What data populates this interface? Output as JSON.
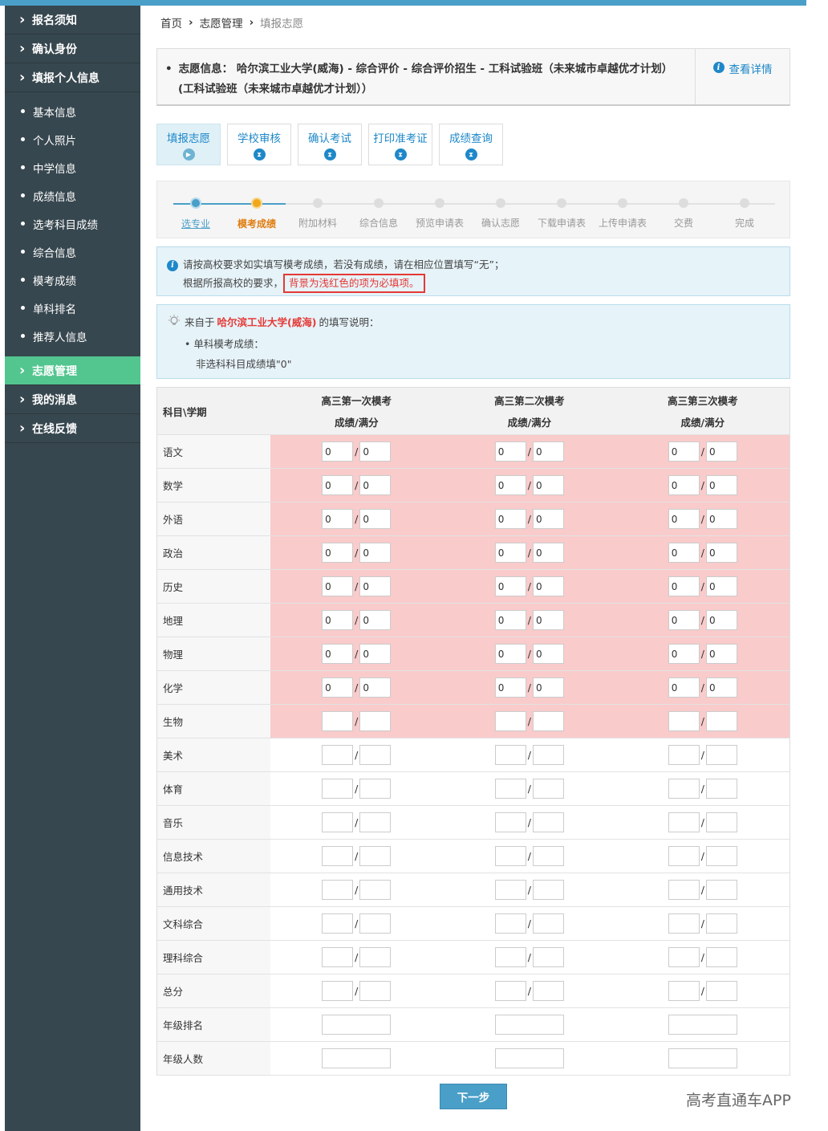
{
  "sidebar": {
    "main_items_top": [
      {
        "label": "报名须知",
        "icon": "chevron-right-icon"
      },
      {
        "label": "确认身份",
        "icon": "chevron-right-icon"
      },
      {
        "label": "填报个人信息",
        "icon": "chevron-right-icon"
      }
    ],
    "sub_items": [
      "基本信息",
      "个人照片",
      "中学信息",
      "成绩信息",
      "选考科目成绩",
      "综合信息",
      "模考成绩",
      "单科排名",
      "推荐人信息"
    ],
    "main_items_bottom": [
      {
        "label": "志愿管理",
        "icon": "chevron-right-icon",
        "active": true
      },
      {
        "label": "我的消息",
        "icon": "chevron-right-icon"
      },
      {
        "label": "在线反馈",
        "icon": "chevron-right-icon"
      }
    ],
    "active_color": "#53c58f"
  },
  "breadcrumb": {
    "items": [
      "首页",
      "志愿管理",
      "填报志愿"
    ],
    "separator": "›"
  },
  "info": {
    "label": "志愿信息：",
    "line1": "哈尔滨工业大学(威海) - 综合评价 - 综合评价招生 - 工科试验班（未来城市卓越优才计划）",
    "line2": "(工科试验班（未来城市卓越优才计划））",
    "detail_link": "查看详情"
  },
  "tabs": [
    {
      "label": "填报志愿",
      "icon": "play-icon",
      "active": true
    },
    {
      "label": "学校审核",
      "icon": "hourglass-icon"
    },
    {
      "label": "确认考试",
      "icon": "hourglass-icon"
    },
    {
      "label": "打印准考证",
      "icon": "hourglass-icon"
    },
    {
      "label": "成绩查询",
      "icon": "hourglass-icon"
    }
  ],
  "steps": [
    "选专业",
    "模考成绩",
    "附加材料",
    "综合信息",
    "预览申请表",
    "确认志愿",
    "下载申请表",
    "上传申请表",
    "交费",
    "完成"
  ],
  "notice": {
    "line1": "请按高校要求如实填写模考成绩，若没有成绩，请在相应位置填写“无”；",
    "line2_prefix": "根据所报高校的要求，",
    "line2_highlight": "背景为浅红色的项为必填项。"
  },
  "description": {
    "prefix": "来自于",
    "school": "哈尔滨工业大学(威海)",
    "suffix": "的填写说明：",
    "item": "单科模考成绩：",
    "note": "非选科科目成绩填\"0\""
  },
  "table": {
    "subject_header": "科目\\学期",
    "columns": [
      {
        "title": "高三第一次模考",
        "subtitle": "成绩/满分"
      },
      {
        "title": "高三第二次模考",
        "subtitle": "成绩/满分"
      },
      {
        "title": "高三第三次模考",
        "subtitle": "成绩/满分"
      }
    ],
    "required_color": "#f9cbcb",
    "rows": [
      {
        "subject": "语文",
        "required": true,
        "score": "0",
        "full": "0"
      },
      {
        "subject": "数学",
        "required": true,
        "score": "0",
        "full": "0"
      },
      {
        "subject": "外语",
        "required": true,
        "score": "0",
        "full": "0"
      },
      {
        "subject": "政治",
        "required": true,
        "score": "0",
        "full": "0"
      },
      {
        "subject": "历史",
        "required": true,
        "score": "0",
        "full": "0"
      },
      {
        "subject": "地理",
        "required": true,
        "score": "0",
        "full": "0"
      },
      {
        "subject": "物理",
        "required": true,
        "score": "0",
        "full": "0"
      },
      {
        "subject": "化学",
        "required": true,
        "score": "0",
        "full": "0"
      },
      {
        "subject": "生物",
        "required": true,
        "score": "",
        "full": ""
      },
      {
        "subject": "美术",
        "required": false,
        "score": "",
        "full": ""
      },
      {
        "subject": "体育",
        "required": false,
        "score": "",
        "full": ""
      },
      {
        "subject": "音乐",
        "required": false,
        "score": "",
        "full": ""
      },
      {
        "subject": "信息技术",
        "required": false,
        "score": "",
        "full": ""
      },
      {
        "subject": "通用技术",
        "required": false,
        "score": "",
        "full": ""
      },
      {
        "subject": "文科综合",
        "required": false,
        "score": "",
        "full": ""
      },
      {
        "subject": "理科综合",
        "required": false,
        "score": "",
        "full": ""
      },
      {
        "subject": "总分",
        "required": false,
        "score": "",
        "full": ""
      },
      {
        "subject": "年级排名",
        "required": false,
        "single": true
      },
      {
        "subject": "年级人数",
        "required": false,
        "single": true
      }
    ]
  },
  "next_button": "下一步",
  "watermark": "高考直通车APP"
}
